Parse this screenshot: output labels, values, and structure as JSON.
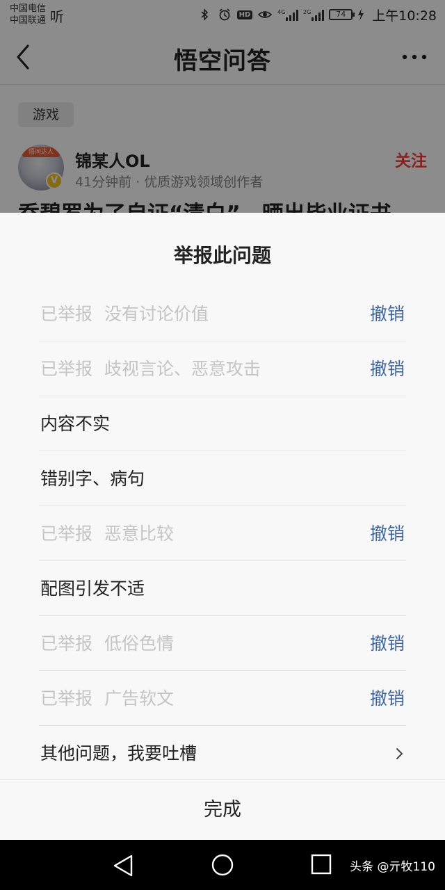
{
  "status_bar": {
    "carrier_1": "中国电信",
    "carrier_2": "中国联通",
    "listen_label": "听",
    "hd_label": "HD",
    "net_4g": "4G",
    "net_2g": "2G",
    "battery_level": "74",
    "time": "上午10:28"
  },
  "header": {
    "title": "悟空问答",
    "back_icon": "chevron-left-icon",
    "more_icon": "more-dots-icon"
  },
  "article": {
    "tag": "游戏",
    "avatar_banner": "悟问达人",
    "verified_badge": "V",
    "author_name": "锦某人OL",
    "author_meta": "41分钟前 · 优质游戏领域创作者",
    "follow_label": "关注",
    "title_partial": "乔碧罗为了自证“清白”，晒出毕业证书"
  },
  "sheet": {
    "title": "举报此问题",
    "reported_prefix": "已举报",
    "cancel_label": "撤销",
    "options": [
      {
        "label": "没有讨论价值",
        "reported": true
      },
      {
        "label": "歧视言论、恶意攻击",
        "reported": true
      },
      {
        "label": "内容不实",
        "reported": false
      },
      {
        "label": "错别字、病句",
        "reported": false
      },
      {
        "label": "恶意比较",
        "reported": true
      },
      {
        "label": "配图引发不适",
        "reported": false
      },
      {
        "label": "低俗色情",
        "reported": true
      },
      {
        "label": "广告软文",
        "reported": true
      },
      {
        "label": "其他问题，我要吐槽",
        "reported": false,
        "has_chevron": true
      }
    ],
    "done_label": "完成"
  },
  "nav_bar": {
    "icons": [
      "nav-back-icon",
      "nav-home-icon",
      "nav-recent-icon"
    ],
    "watermark": "头条 @亓牧110"
  },
  "colors": {
    "accent_red": "#f04142",
    "cancel_blue": "#406599",
    "disabled_gray": "#c4c4c4"
  }
}
